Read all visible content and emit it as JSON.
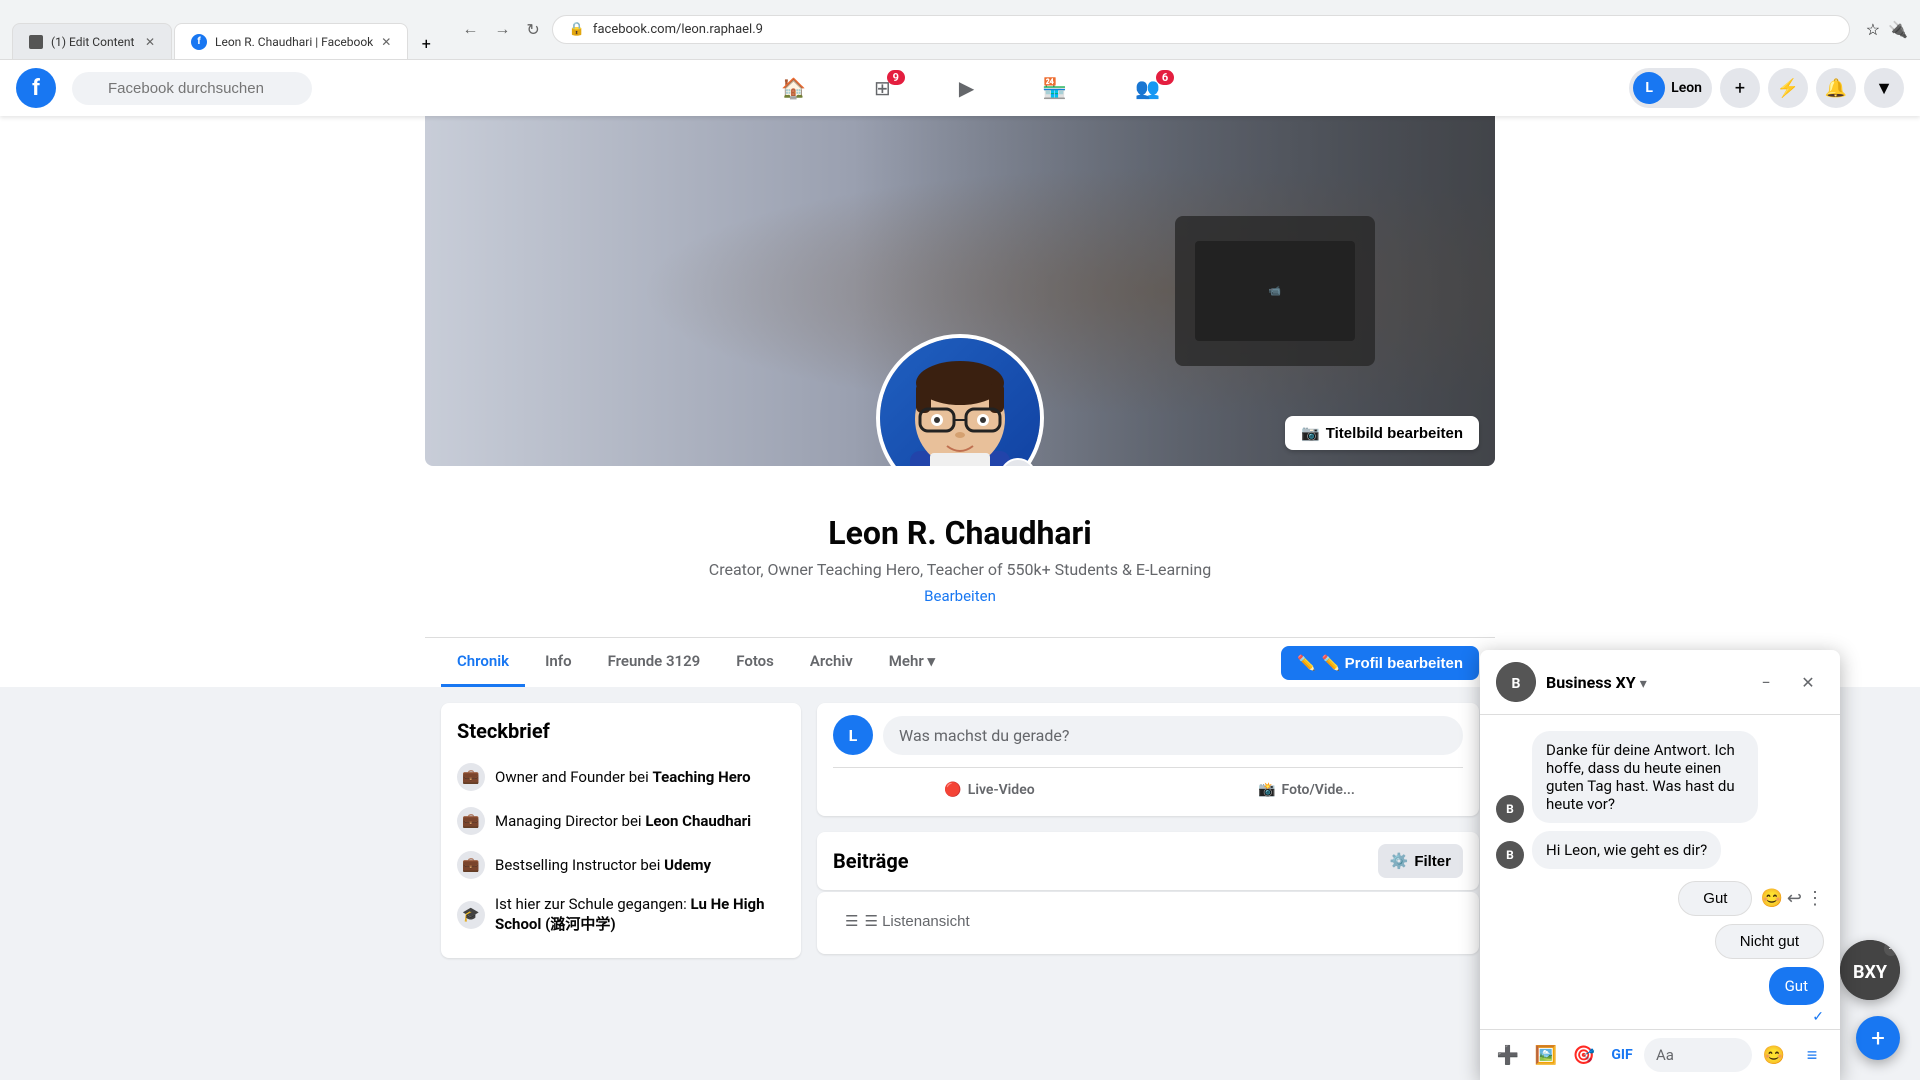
{
  "browser": {
    "url": "facebook.com/leon.raphael.9",
    "tab1_label": "(1) Edit Content",
    "tab2_label": "Leon R. Chaudhari | Facebook",
    "tab2_favicon": "f"
  },
  "header": {
    "logo": "f",
    "search_placeholder": "Facebook durchsuchen",
    "nav_items": [
      {
        "id": "home",
        "icon": "🏠",
        "active": false
      },
      {
        "id": "video",
        "icon": "🎬",
        "badge": null,
        "active": false
      },
      {
        "id": "store",
        "icon": "🏪",
        "badge": null,
        "active": false
      },
      {
        "id": "friends",
        "icon": "👥",
        "badge": "6",
        "active": false
      }
    ],
    "menu_badge": "9",
    "user_name": "Leon",
    "add_btn": "+",
    "messenger_icon": "💬",
    "bell_icon": "🔔",
    "chevron_icon": "▼"
  },
  "profile": {
    "cover_edit_btn": "📷 Titelbild bearbeiten",
    "name": "Leon R. Chaudhari",
    "bio": "Creator, Owner Teaching Hero, Teacher of 550k+ Students & E-Learning",
    "edit_link": "Bearbeiten",
    "tabs": [
      {
        "label": "Chronik",
        "active": true
      },
      {
        "label": "Info",
        "active": false
      },
      {
        "label": "Freunde",
        "count": "3129",
        "active": false
      },
      {
        "label": "Fotos",
        "active": false
      },
      {
        "label": "Archiv",
        "active": false
      },
      {
        "label": "Mehr",
        "has_arrow": true,
        "active": false
      }
    ],
    "action_btn": "✏️ Profil bearbeiten"
  },
  "steckbrief": {
    "title": "Steckbrief",
    "items": [
      {
        "icon": "💼",
        "text": "Owner and Founder bei ",
        "bold": "Teaching Hero"
      },
      {
        "icon": "💼",
        "text": "Managing Director bei ",
        "bold": "Leon Chaudhari"
      },
      {
        "icon": "💼",
        "text": "Bestselling Instructor bei ",
        "bold": "Udemy"
      },
      {
        "icon": "🎓",
        "text": "Ist hier zur Schule gegangen: ",
        "bold": "Lu He High School (潞河中学)"
      }
    ]
  },
  "composer": {
    "placeholder": "Was machst du gerade?",
    "actions": [
      {
        "icon": "🔴",
        "label": "Live-Video"
      },
      {
        "icon": "📸",
        "label": "Foto/Vide..."
      }
    ]
  },
  "posts": {
    "title": "Beiträge",
    "filter_btn": "⚙️ Filter",
    "list_view_btn": "☰ Listenansicht"
  },
  "chat": {
    "page_name": "Business XY",
    "chevron": "▾",
    "minimize": "−",
    "close": "✕",
    "messages": [
      {
        "type": "received",
        "text": "Danke für deine Antwort. Ich hoffe, dass du heute einen guten Tag hast. Was hast du heute vor?"
      },
      {
        "type": "received",
        "text": "Hi Leon, wie geht es dir?"
      }
    ],
    "quick_replies": [
      "Gut",
      "Nicht gut"
    ],
    "sent_message": "Gut",
    "footer_icons": [
      "➕",
      "🖼️",
      "🎯",
      "GIF",
      "Aa",
      "😊",
      "≡"
    ]
  }
}
